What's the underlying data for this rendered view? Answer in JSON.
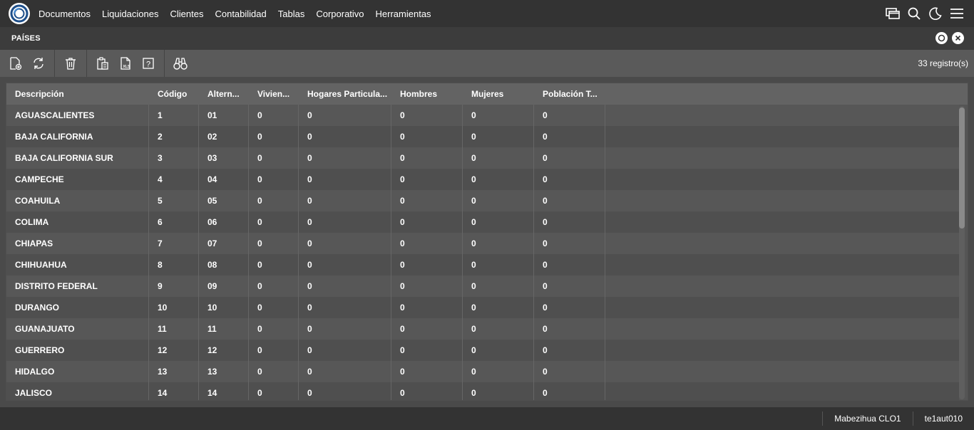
{
  "nav": {
    "items": [
      "Documentos",
      "Liquidaciones",
      "Clientes",
      "Contabilidad",
      "Tablas",
      "Corporativo",
      "Herramientas"
    ]
  },
  "top_icons": [
    "windows-icon",
    "search-icon",
    "moon-icon",
    "menu-icon"
  ],
  "page": {
    "title": "PAÍSES"
  },
  "toolbar": {
    "record_count": "33 registro(s)"
  },
  "grid": {
    "columns": [
      "Descripción",
      "Código",
      "Altern...",
      "Vivien...",
      "Hogares Particula...",
      "Hombres",
      "Mujeres",
      "Población T..."
    ],
    "rows": [
      [
        "AGUASCALIENTES",
        "1",
        "01",
        "0",
        "0",
        "0",
        "0",
        "0"
      ],
      [
        "BAJA CALIFORNIA",
        "2",
        "02",
        "0",
        "0",
        "0",
        "0",
        "0"
      ],
      [
        "BAJA CALIFORNIA SUR",
        "3",
        "03",
        "0",
        "0",
        "0",
        "0",
        "0"
      ],
      [
        "CAMPECHE",
        "4",
        "04",
        "0",
        "0",
        "0",
        "0",
        "0"
      ],
      [
        "COAHUILA",
        "5",
        "05",
        "0",
        "0",
        "0",
        "0",
        "0"
      ],
      [
        "COLIMA",
        "6",
        "06",
        "0",
        "0",
        "0",
        "0",
        "0"
      ],
      [
        "CHIAPAS",
        "7",
        "07",
        "0",
        "0",
        "0",
        "0",
        "0"
      ],
      [
        "CHIHUAHUA",
        "8",
        "08",
        "0",
        "0",
        "0",
        "0",
        "0"
      ],
      [
        "DISTRITO FEDERAL",
        "9",
        "09",
        "0",
        "0",
        "0",
        "0",
        "0"
      ],
      [
        "DURANGO",
        "10",
        "10",
        "0",
        "0",
        "0",
        "0",
        "0"
      ],
      [
        "GUANAJUATO",
        "11",
        "11",
        "0",
        "0",
        "0",
        "0",
        "0"
      ],
      [
        "GUERRERO",
        "12",
        "12",
        "0",
        "0",
        "0",
        "0",
        "0"
      ],
      [
        "HIDALGO",
        "13",
        "13",
        "0",
        "0",
        "0",
        "0",
        "0"
      ],
      [
        "JALISCO",
        "14",
        "14",
        "0",
        "0",
        "0",
        "0",
        "0"
      ]
    ]
  },
  "status": {
    "user": "Mabezihua CLO1",
    "session": "te1aut010"
  }
}
